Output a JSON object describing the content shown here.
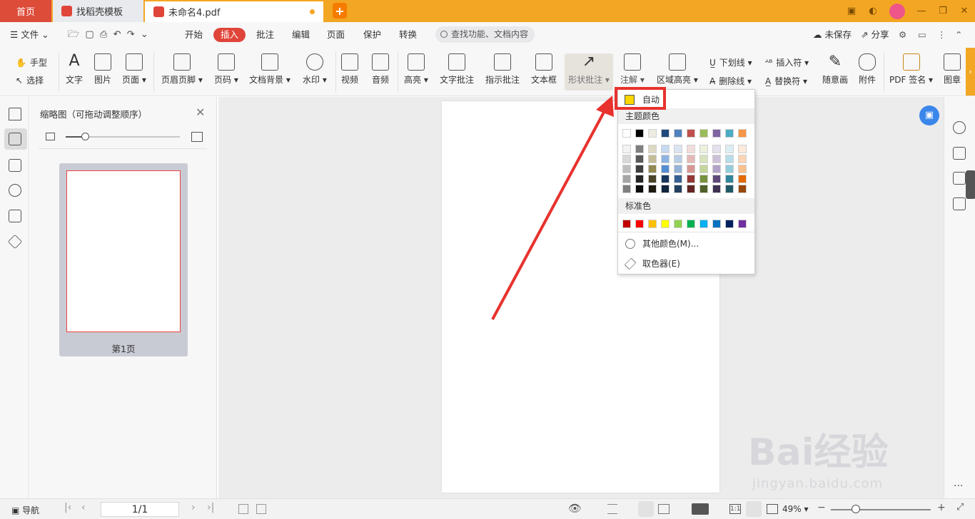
{
  "tabs": {
    "home": "首页",
    "template": "找稻壳模板",
    "doc": "未命名4.pdf"
  },
  "menu": {
    "file": "文件",
    "items": [
      "开始",
      "插入",
      "批注",
      "编辑",
      "页面",
      "保护",
      "转换"
    ],
    "active_index": 1,
    "search_placeholder": "查找功能、文档内容",
    "unsaved": "未保存",
    "share": "分享"
  },
  "ribbon": {
    "hand": "手型",
    "select": "选择",
    "buttons": [
      {
        "label": "文字"
      },
      {
        "label": "图片"
      },
      {
        "label": "页面 ▾"
      },
      {
        "label": "页眉页脚 ▾"
      },
      {
        "label": "页码 ▾"
      },
      {
        "label": "文档背景 ▾"
      },
      {
        "label": "水印 ▾"
      },
      {
        "label": "视频"
      },
      {
        "label": "音频"
      },
      {
        "label": "高亮 ▾"
      },
      {
        "label": "文字批注"
      },
      {
        "label": "指示批注"
      },
      {
        "label": "文本框"
      },
      {
        "label": "形状批注 ▾"
      },
      {
        "label": "注解 ▾"
      },
      {
        "label": "区域高亮 ▾"
      }
    ],
    "underline": "下划线 ▾",
    "strikethrough": "删除线 ▾",
    "insert_char": "插入符 ▾",
    "replace_char": "替换符 ▾",
    "draw": "随意画",
    "attachment": "附件",
    "pdf_sign": "PDF 签名 ▾",
    "stamp": "图章"
  },
  "thumbnail_panel": {
    "title": "缩略图（可拖动调整顺序）",
    "page_label": "第1页"
  },
  "color_dropdown": {
    "auto": "自动",
    "theme_header": "主题颜色",
    "standard_header": "标准色",
    "more_colors": "其他颜色(M)...",
    "picker": "取色器(E)",
    "theme_top": [
      "#ffffff",
      "#000000",
      "#eeece1",
      "#1f497d",
      "#4f81bd",
      "#c0504d",
      "#9bbb59",
      "#8064a2",
      "#4bacc6",
      "#f79646"
    ],
    "theme_shades": [
      [
        "#f2f2f2",
        "#7f7f7f",
        "#ddd9c3",
        "#c6d9f0",
        "#dbe5f1",
        "#f2dcdb",
        "#ebf1dd",
        "#e5e0ec",
        "#dbeef3",
        "#fdeada"
      ],
      [
        "#d8d8d8",
        "#595959",
        "#c4bd97",
        "#8db3e2",
        "#b8cce4",
        "#e5b9b7",
        "#d7e3bc",
        "#ccc1d9",
        "#b7dde8",
        "#fbd5b5"
      ],
      [
        "#bfbfbf",
        "#3f3f3f",
        "#938953",
        "#548dd4",
        "#95b3d7",
        "#d99694",
        "#c3d69b",
        "#b2a2c7",
        "#92cddc",
        "#fac08f"
      ],
      [
        "#a5a5a5",
        "#262626",
        "#494429",
        "#17365d",
        "#366092",
        "#953734",
        "#76923c",
        "#5f497a",
        "#31859b",
        "#e36c09"
      ],
      [
        "#7f7f7f",
        "#0c0c0c",
        "#1d1b10",
        "#0f243e",
        "#244061",
        "#632423",
        "#4f6128",
        "#3f3151",
        "#205867",
        "#974806"
      ]
    ],
    "standard": [
      "#c00000",
      "#ff0000",
      "#ffc000",
      "#ffff00",
      "#92d050",
      "#00b050",
      "#00b0f0",
      "#0070c0",
      "#002060",
      "#7030a0"
    ]
  },
  "status": {
    "nav": "导航",
    "page": "1/1",
    "zoom": "49%"
  },
  "watermark": {
    "text": "Bai经验",
    "sub": "jingyan.baidu.com"
  }
}
